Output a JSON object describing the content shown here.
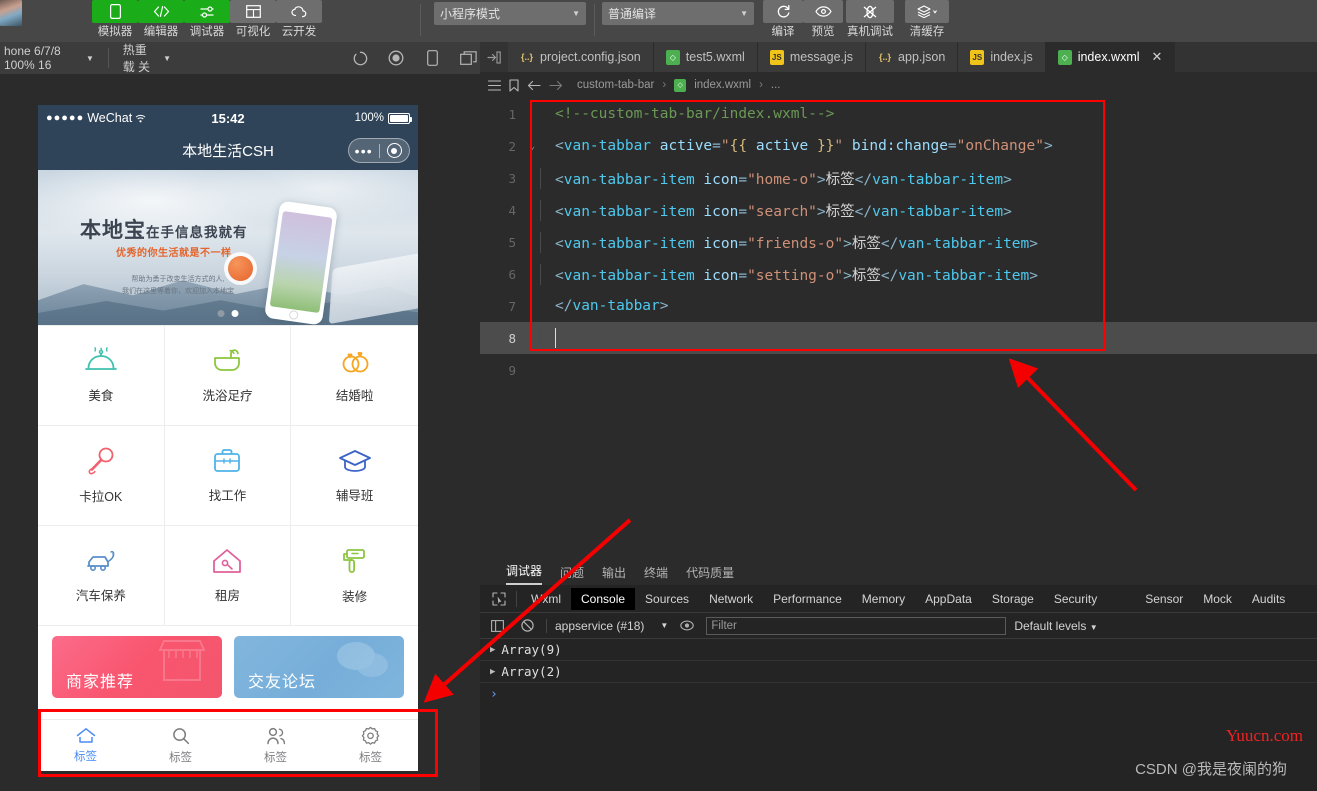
{
  "toolbar": {
    "buttons": [
      {
        "label": "模拟器",
        "icon": "simulator-icon",
        "style": "green"
      },
      {
        "label": "编辑器",
        "icon": "code-icon",
        "style": "green"
      },
      {
        "label": "调试器",
        "icon": "sliders-icon",
        "style": "green"
      },
      {
        "label": "可视化",
        "icon": "layout-icon",
        "style": "grey"
      },
      {
        "label": "云开发",
        "icon": "cloud-icon",
        "style": "grey"
      }
    ],
    "mode_select": "小程序模式",
    "compile_select": "普通编译",
    "actions": [
      {
        "label": "编译",
        "icon": "refresh-icon"
      },
      {
        "label": "预览",
        "icon": "eye-icon"
      },
      {
        "label": "真机调试",
        "icon": "device-debug-icon"
      },
      {
        "label": "清缓存",
        "icon": "layers-icon"
      }
    ]
  },
  "subbar": {
    "device": "hone 6/7/8 100% 16",
    "hotreload": "热重载 关",
    "icons": [
      "refresh-circle-icon",
      "record-icon",
      "phone-icon",
      "windows-icon"
    ]
  },
  "simulator": {
    "status": {
      "carrier": "WeChat",
      "dots": "●●●●●",
      "time": "15:42",
      "battery": "100%"
    },
    "nav_title": "本地生活CSH",
    "banner": {
      "title_big": "本地宝",
      "title_small": "在手信息我就有",
      "subtitle": "优秀的你生活就是不一样",
      "desc_line1": "帮助为勇于改变生活方式的人,",
      "desc_line2": "我们在这里等着你，欢迎加入本地宝"
    },
    "grid": [
      {
        "label": "美食",
        "icon": "food-cloche-icon",
        "color": "#3fc1ad"
      },
      {
        "label": "洗浴足疗",
        "icon": "bath-icon",
        "color": "#8cc63f"
      },
      {
        "label": "结婚啦",
        "icon": "wedding-rings-icon",
        "color": "#f5a623"
      },
      {
        "label": "卡拉OK",
        "icon": "microphone-icon",
        "color": "#f0616d"
      },
      {
        "label": "找工作",
        "icon": "briefcase-icon",
        "color": "#4fb3e8"
      },
      {
        "label": "辅导班",
        "icon": "graduation-cap-icon",
        "color": "#3b63c8"
      },
      {
        "label": "汽车保养",
        "icon": "car-wash-icon",
        "color": "#5b8ec9"
      },
      {
        "label": "租房",
        "icon": "house-key-icon",
        "color": "#e0609c"
      },
      {
        "label": "装修",
        "icon": "paint-roller-icon",
        "color": "#8cc63f"
      }
    ],
    "cards": [
      {
        "label": "商家推荐",
        "icon": "shop-icon",
        "color": "#f9556f"
      },
      {
        "label": "交友论坛",
        "icon": "chat-icon",
        "color": "#7fb5dd"
      }
    ],
    "tabbar": [
      {
        "label": "标签",
        "icon": "home-o-icon",
        "active": true
      },
      {
        "label": "标签",
        "icon": "search-icon",
        "active": false
      },
      {
        "label": "标签",
        "icon": "friends-o-icon",
        "active": false
      },
      {
        "label": "标签",
        "icon": "setting-o-icon",
        "active": false
      }
    ]
  },
  "editor": {
    "tabs": [
      {
        "label": "project.config.json",
        "type": "json",
        "tag": "{..}",
        "active": false,
        "closable": false
      },
      {
        "label": "test5.wxml",
        "type": "wxml",
        "tag": "◇",
        "active": false,
        "closable": false
      },
      {
        "label": "message.js",
        "type": "js",
        "tag": "JS",
        "active": false,
        "closable": false
      },
      {
        "label": "app.json",
        "type": "json",
        "tag": "{..}",
        "active": false,
        "closable": false
      },
      {
        "label": "index.js",
        "type": "js",
        "tag": "JS",
        "active": false,
        "closable": false
      },
      {
        "label": "index.wxml",
        "type": "wxml",
        "tag": "◇",
        "active": true,
        "closable": true
      }
    ],
    "close_label": "✕",
    "breadcrumb": [
      "custom-tab-bar",
      "index.wxml",
      "..."
    ],
    "code_lines": [
      {
        "num": "1",
        "fold": "",
        "indent": 0,
        "tokens": [
          {
            "t": "com",
            "v": "<!--custom-tab-bar/index.wxml-->"
          }
        ]
      },
      {
        "num": "2",
        "fold": "⌄",
        "indent": 0,
        "tokens": [
          {
            "t": "br",
            "v": "<"
          },
          {
            "t": "tag",
            "v": "van-tabbar"
          },
          {
            "t": "txt",
            "v": " "
          },
          {
            "t": "attr",
            "v": "active"
          },
          {
            "t": "br",
            "v": "="
          },
          {
            "t": "str",
            "v": "\""
          },
          {
            "t": "mus",
            "v": "{{"
          },
          {
            "t": "var",
            "v": " active "
          },
          {
            "t": "mus",
            "v": "}}"
          },
          {
            "t": "str",
            "v": "\""
          },
          {
            "t": "txt",
            "v": " "
          },
          {
            "t": "attr",
            "v": "bind:change"
          },
          {
            "t": "br",
            "v": "="
          },
          {
            "t": "str",
            "v": "\"onChange\""
          },
          {
            "t": "br",
            "v": ">"
          }
        ]
      },
      {
        "num": "3",
        "fold": "",
        "indent": 1,
        "tokens": [
          {
            "t": "br",
            "v": "<"
          },
          {
            "t": "tag",
            "v": "van-tabbar-item"
          },
          {
            "t": "txt",
            "v": " "
          },
          {
            "t": "attr",
            "v": "icon"
          },
          {
            "t": "br",
            "v": "="
          },
          {
            "t": "str",
            "v": "\"home-o\""
          },
          {
            "t": "br",
            "v": ">"
          },
          {
            "t": "txt",
            "v": "标签"
          },
          {
            "t": "br",
            "v": "</"
          },
          {
            "t": "tag",
            "v": "van-tabbar-item"
          },
          {
            "t": "br",
            "v": ">"
          }
        ]
      },
      {
        "num": "4",
        "fold": "",
        "indent": 1,
        "tokens": [
          {
            "t": "br",
            "v": "<"
          },
          {
            "t": "tag",
            "v": "van-tabbar-item"
          },
          {
            "t": "txt",
            "v": " "
          },
          {
            "t": "attr",
            "v": "icon"
          },
          {
            "t": "br",
            "v": "="
          },
          {
            "t": "str",
            "v": "\"search\""
          },
          {
            "t": "br",
            "v": ">"
          },
          {
            "t": "txt",
            "v": "标签"
          },
          {
            "t": "br",
            "v": "</"
          },
          {
            "t": "tag",
            "v": "van-tabbar-item"
          },
          {
            "t": "br",
            "v": ">"
          }
        ]
      },
      {
        "num": "5",
        "fold": "",
        "indent": 1,
        "tokens": [
          {
            "t": "br",
            "v": "<"
          },
          {
            "t": "tag",
            "v": "van-tabbar-item"
          },
          {
            "t": "txt",
            "v": " "
          },
          {
            "t": "attr",
            "v": "icon"
          },
          {
            "t": "br",
            "v": "="
          },
          {
            "t": "str",
            "v": "\"friends-o\""
          },
          {
            "t": "br",
            "v": ">"
          },
          {
            "t": "txt",
            "v": "标签"
          },
          {
            "t": "br",
            "v": "</"
          },
          {
            "t": "tag",
            "v": "van-tabbar-item"
          },
          {
            "t": "br",
            "v": ">"
          }
        ]
      },
      {
        "num": "6",
        "fold": "",
        "indent": 1,
        "tokens": [
          {
            "t": "br",
            "v": "<"
          },
          {
            "t": "tag",
            "v": "van-tabbar-item"
          },
          {
            "t": "txt",
            "v": " "
          },
          {
            "t": "attr",
            "v": "icon"
          },
          {
            "t": "br",
            "v": "="
          },
          {
            "t": "str",
            "v": "\"setting-o\""
          },
          {
            "t": "br",
            "v": ">"
          },
          {
            "t": "txt",
            "v": "标签"
          },
          {
            "t": "br",
            "v": "</"
          },
          {
            "t": "tag",
            "v": "van-tabbar-item"
          },
          {
            "t": "br",
            "v": ">"
          }
        ]
      },
      {
        "num": "7",
        "fold": "",
        "indent": 0,
        "tokens": [
          {
            "t": "br",
            "v": "</"
          },
          {
            "t": "tag",
            "v": "van-tabbar"
          },
          {
            "t": "br",
            "v": ">"
          }
        ]
      },
      {
        "num": "8",
        "fold": "",
        "indent": 1,
        "current": true,
        "tokens": []
      },
      {
        "num": "9",
        "fold": "",
        "indent": 0,
        "tokens": []
      }
    ]
  },
  "devtools": {
    "top_tabs": [
      {
        "label": "调试器",
        "active": true
      },
      {
        "label": "问题",
        "active": false
      },
      {
        "label": "输出",
        "active": false
      },
      {
        "label": "终端",
        "active": false
      },
      {
        "label": "代码质量",
        "active": false
      }
    ],
    "panels": [
      {
        "label": "Wxml",
        "active": false
      },
      {
        "label": "Console",
        "active": true
      },
      {
        "label": "Sources",
        "active": false
      },
      {
        "label": "Network",
        "active": false
      },
      {
        "label": "Performance",
        "active": false
      },
      {
        "label": "Memory",
        "active": false
      },
      {
        "label": "AppData",
        "active": false
      },
      {
        "label": "Storage",
        "active": false
      },
      {
        "label": "Security",
        "active": false
      },
      {
        "label": "Sensor",
        "active": false
      },
      {
        "label": "Mock",
        "active": false
      },
      {
        "label": "Audits",
        "active": false
      }
    ],
    "context": "appservice (#18)",
    "filter_placeholder": "Filter",
    "levels": "Default levels",
    "console_rows": [
      "Array(9)",
      "Array(2)"
    ],
    "prompt": "›"
  },
  "watermark": {
    "site": "Yuucn.com",
    "credit": "CSDN @我是夜阑的狗"
  }
}
